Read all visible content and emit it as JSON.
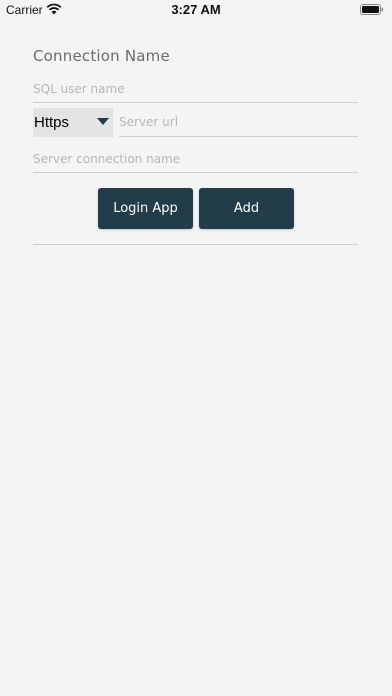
{
  "status_bar": {
    "carrier": "Carrier",
    "time": "3:27 AM",
    "wifi_icon": "wifi-icon",
    "battery_icon": "battery-icon"
  },
  "form": {
    "title": "Connection Name",
    "sql_user": {
      "value": "",
      "placeholder": "SQL user name"
    },
    "protocol": {
      "selected": "Https",
      "icon": "dropdown-triangle-icon"
    },
    "server_url": {
      "value": "",
      "placeholder": "Server url"
    },
    "connection_name": {
      "value": "",
      "placeholder": "Server connection name"
    },
    "buttons": {
      "login_label": "Login App",
      "add_label": "Add"
    }
  },
  "colors": {
    "background": "#f4f4f4",
    "button": "#223d49",
    "button_text": "#ffffff",
    "select_background": "#e3e3e3",
    "divider": "#cfcfcf"
  }
}
